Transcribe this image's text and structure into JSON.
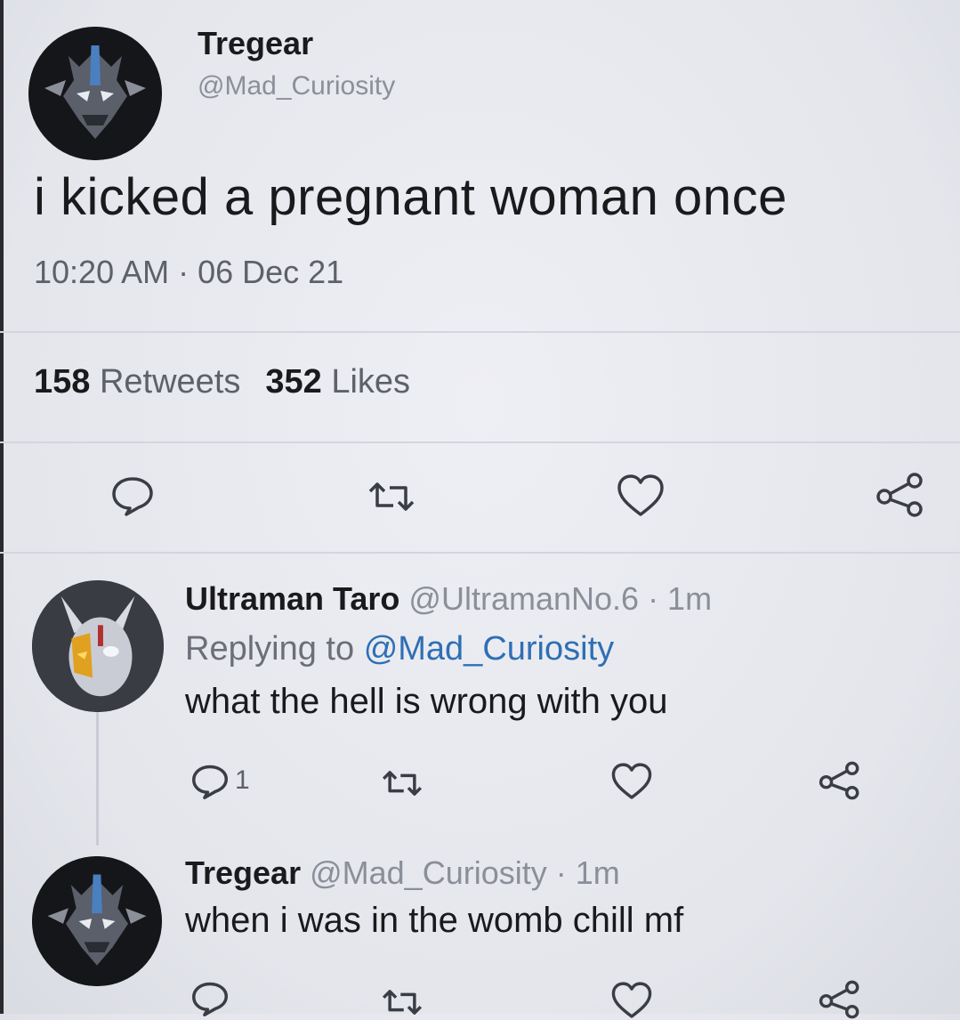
{
  "tweet": {
    "author_name": "Tregear",
    "author_handle": "@Mad_Curiosity",
    "text": "i kicked a pregnant woman once",
    "timestamp": "10:20 AM · 06 Dec 21",
    "retweets_count": "158",
    "retweets_label": "Retweets",
    "likes_count": "352",
    "likes_label": "Likes",
    "actions": [
      "reply-icon",
      "retweet-icon",
      "like-icon",
      "share-icon"
    ]
  },
  "replies": [
    {
      "author_name": "Ultraman Taro",
      "author_handle": "@UltramanNo.6",
      "time": "· 1m",
      "replying_prefix": "Replying to",
      "replying_to": "@Mad_Curiosity",
      "text": "what the hell is wrong with you",
      "reply_count": "1"
    },
    {
      "author_name": "Tregear",
      "author_handle": "@Mad_Curiosity",
      "time": "· 1m",
      "text": "when i was in the womb chill mf"
    }
  ],
  "colors": {
    "background": "#e6e8ee",
    "text": "#1a1a1d",
    "muted": "#8a8f99",
    "mention": "#2f6fb5"
  }
}
